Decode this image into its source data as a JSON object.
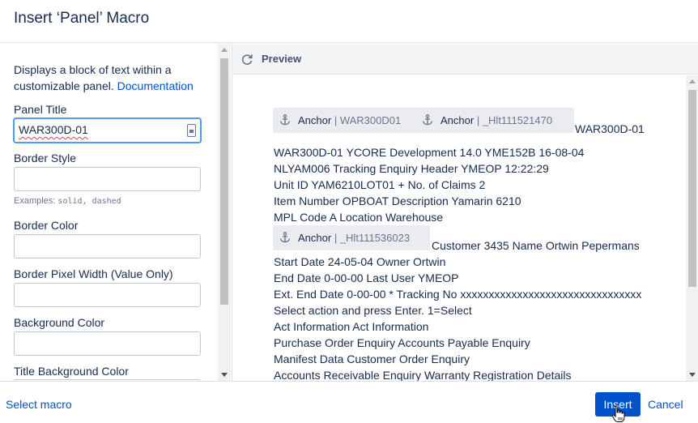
{
  "dialog": {
    "title": "Insert ‘Panel’ Macro"
  },
  "left": {
    "description": "Displays a block of text within a customizable panel.",
    "documentation_link": "Documentation",
    "fields": [
      {
        "label": "Panel Title",
        "value": "WAR300D-01"
      },
      {
        "label": "Border Style",
        "value": "",
        "hint_prefix": "Examples:",
        "hint_code": "solid, dashed"
      },
      {
        "label": "Border Color",
        "value": ""
      },
      {
        "label": "Border Pixel Width (Value Only)",
        "value": ""
      },
      {
        "label": "Background Color",
        "value": ""
      },
      {
        "label": "Title Background Color",
        "value": ""
      }
    ]
  },
  "preview": {
    "label": "Preview",
    "anchors_row1": [
      {
        "name": "Anchor",
        "value": "WAR300D01"
      },
      {
        "name": "Anchor",
        "value": "_Hlt111521470"
      }
    ],
    "after_row1": "WAR300D-01",
    "lines_a": [
      "WAR300D-01 YCORE Development 14.0 YME152B 16-08-04",
      "NLYAM006 Tracking Enquiry Header YMEOP 12:22:29",
      "Unit ID YAM6210LOT01 + No. of Claims 2",
      "Item Number OPBOAT Description Yamarin 6210",
      "MPL Code A Location Warehouse"
    ],
    "anchors_row2": [
      {
        "name": "Anchor",
        "value": "_Hlt111536023"
      }
    ],
    "after_row2": "Customer 3435 Name Ortwin Pepermans",
    "lines_b": [
      "Start Date 24-05-04 Owner Ortwin",
      "End Date 0-00-00 Last User YMEOP",
      "Ext. End Date 0-00-00 * Tracking No xxxxxxxxxxxxxxxxxxxxxxxxxxxxxxxx",
      "Select action and press Enter. 1=Select",
      "Act Information Act Information",
      "Purchase Order Enquiry Accounts Payable Enquiry",
      "Manifest Data Customer Order Enquiry",
      "Accounts Receivable Enquiry Warranty Registration Details"
    ]
  },
  "footer": {
    "select_macro": "Select macro",
    "insert": "Insert",
    "cancel": "Cancel"
  },
  "colors": {
    "primary": "#0052cc",
    "text": "#172b4d",
    "focus": "#4c9aff",
    "anchor_bg": "#ebecf0"
  }
}
